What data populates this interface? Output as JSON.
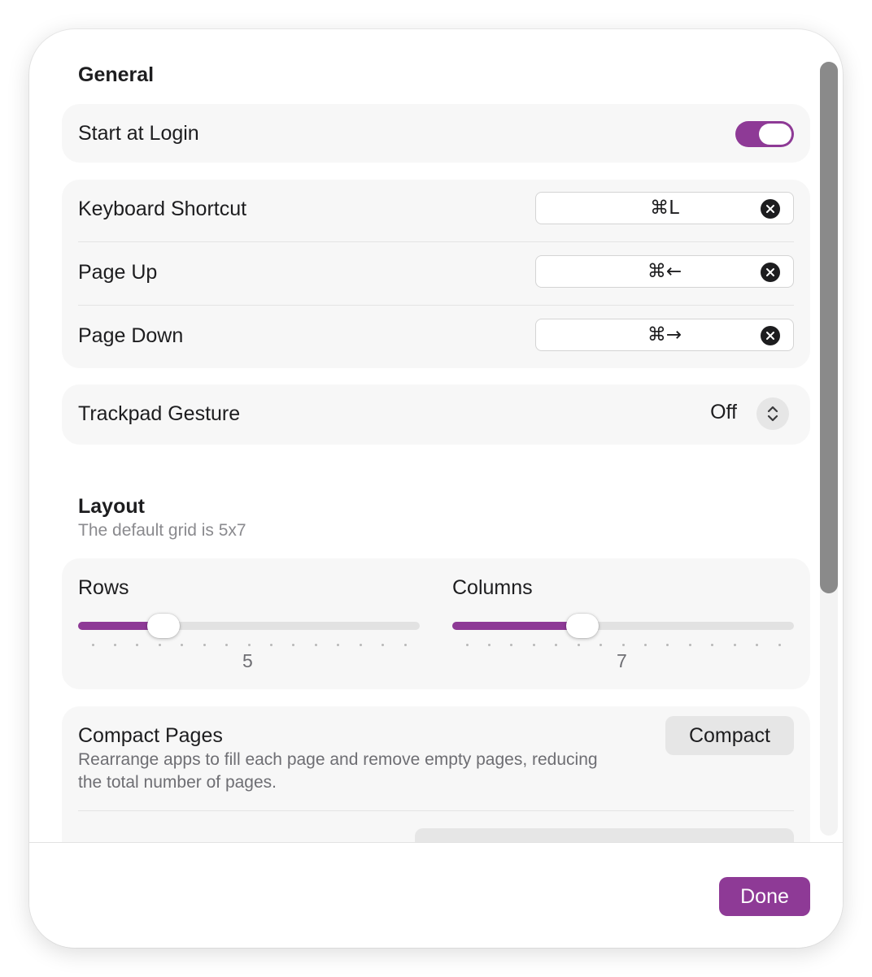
{
  "general": {
    "title": "General",
    "start_at_login": {
      "label": "Start at Login",
      "enabled": true
    },
    "shortcuts": [
      {
        "label": "Keyboard Shortcut",
        "value": "⌘L"
      },
      {
        "label": "Page Up",
        "value": "⌘←"
      },
      {
        "label": "Page Down",
        "value": "⌘→"
      }
    ],
    "trackpad_gesture": {
      "label": "Trackpad Gesture",
      "value": "Off"
    }
  },
  "layout": {
    "title": "Layout",
    "subtitle": "The default grid is 5x7",
    "rows": {
      "label": "Rows",
      "value": "5",
      "fraction": 0.25
    },
    "columns": {
      "label": "Columns",
      "value": "7",
      "fraction": 0.38
    }
  },
  "compact": {
    "title": "Compact Pages",
    "description": "Rearrange apps to fill each page and remove empty pages, reducing the total number of pages.",
    "button_label": "Compact"
  },
  "footer": {
    "done_label": "Done"
  },
  "colors": {
    "accent": "#8e3a96",
    "group_bg": "#f7f7f7"
  }
}
